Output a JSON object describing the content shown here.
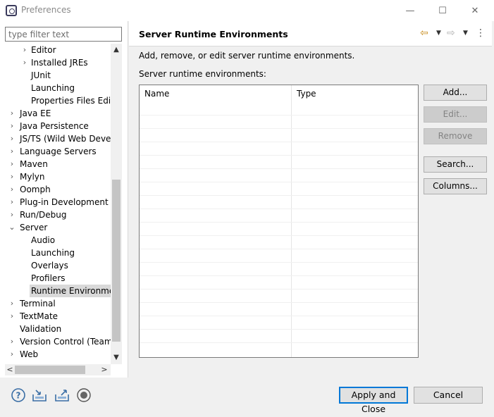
{
  "window": {
    "title": "Preferences",
    "minimize_icon": "—",
    "maximize_icon": "☐",
    "close_icon": "✕"
  },
  "filter": {
    "placeholder": "type filter text",
    "value": ""
  },
  "tree": {
    "items": [
      {
        "label": "Editor",
        "expander": "›"
      },
      {
        "label": "Installed JREs",
        "expander": "›"
      },
      {
        "label": "JUnit",
        "expander": ""
      },
      {
        "label": "Launching",
        "expander": ""
      },
      {
        "label": "Properties Files Editor",
        "expander": ""
      },
      {
        "label": "Java EE",
        "expander": "›"
      },
      {
        "label": "Java Persistence",
        "expander": "›"
      },
      {
        "label": "JS/TS (Wild Web Develo",
        "expander": "›"
      },
      {
        "label": "Language Servers",
        "expander": "›"
      },
      {
        "label": "Maven",
        "expander": "›"
      },
      {
        "label": "Mylyn",
        "expander": "›"
      },
      {
        "label": "Oomph",
        "expander": "›"
      },
      {
        "label": "Plug-in Development",
        "expander": "›"
      },
      {
        "label": "Run/Debug",
        "expander": "›"
      },
      {
        "label": "Server",
        "expander": "⌄"
      },
      {
        "label": "Audio",
        "expander": ""
      },
      {
        "label": "Launching",
        "expander": ""
      },
      {
        "label": "Overlays",
        "expander": ""
      },
      {
        "label": "Profilers",
        "expander": ""
      },
      {
        "label": "Runtime Environmen",
        "expander": ""
      },
      {
        "label": "Terminal",
        "expander": "›"
      },
      {
        "label": "TextMate",
        "expander": "›"
      },
      {
        "label": "Validation",
        "expander": ""
      },
      {
        "label": "Version Control (Team)",
        "expander": "›"
      },
      {
        "label": "Web",
        "expander": "›"
      }
    ],
    "scroll_up": "▲",
    "scroll_down": "▼",
    "scroll_left": "<",
    "scroll_right": ">"
  },
  "page": {
    "title": "Server Runtime Environments",
    "description": "Add, remove, or edit server runtime environments.",
    "list_label": "Server runtime environments:",
    "nav_back_icon": "⇦",
    "nav_forward_icon": "⇨",
    "menu_icon": "⋮",
    "dropdown_icon": "▼"
  },
  "table": {
    "columns": [
      "Name",
      "Type"
    ],
    "rows": []
  },
  "buttons": {
    "add": "Add...",
    "edit": "Edit...",
    "remove": "Remove",
    "search": "Search...",
    "columns": "Columns..."
  },
  "footer": {
    "apply_close": "Apply and Close",
    "cancel": "Cancel",
    "help_icon": "?",
    "import_icon": "⭳",
    "export_icon": "⭱",
    "record_icon": "◉"
  },
  "colors": {
    "accent": "#0078d7",
    "nav_arrow": "#c68a1a"
  }
}
